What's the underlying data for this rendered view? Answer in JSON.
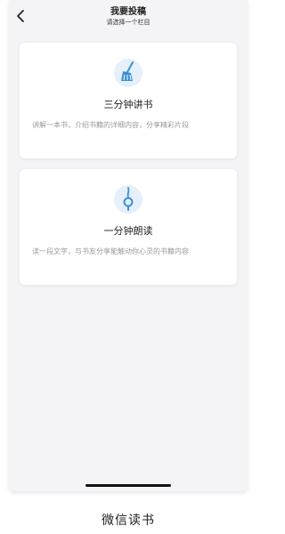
{
  "header": {
    "title": "我要投稿",
    "subtitle": "请选择一个栏目",
    "back_icon": "chevron-left-icon"
  },
  "options": [
    {
      "title": "三分钟讲书",
      "description": "讲解一本书，介绍书籍的详细内容，分享精彩片段",
      "icon": "broom-icon"
    },
    {
      "title": "一分钟朗读",
      "description": "读一段文字，与书友分享能触动你心灵的书籍内容",
      "icon": "microphone-icon"
    }
  ],
  "caption": "微信读书",
  "colors": {
    "accent": "#3b8fd9",
    "icon_bg": "#e6f0fa",
    "background": "#f4f4f6",
    "card": "#ffffff"
  }
}
